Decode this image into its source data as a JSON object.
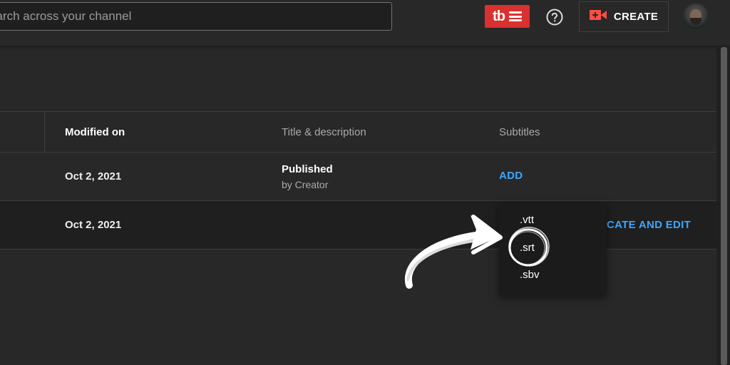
{
  "search": {
    "placeholder": "Search across your channel",
    "visible_text": "earch across your channel"
  },
  "header": {
    "tubebuddy_logo": "tb",
    "help_icon": "help-circle-icon",
    "create_label": "CREATE",
    "colors": {
      "tubebuddy": "#d8312f",
      "create_icon": "#ff4e45",
      "link": "#3ea6ff"
    }
  },
  "table": {
    "columns": [
      {
        "label": "Modified on"
      },
      {
        "label": "Title & description"
      },
      {
        "label": "Subtitles"
      }
    ],
    "rows": [
      {
        "modified": "Oct 2, 2021",
        "title_status": "Published",
        "title_by": "by Creator",
        "subtitles_action": "ADD"
      },
      {
        "modified": "Oct 2, 2021",
        "title_status": "",
        "title_by": "",
        "subtitles_action": "CATE AND EDIT"
      }
    ]
  },
  "dropdown": {
    "options": [
      ".vtt",
      ".srt",
      ".sbv"
    ],
    "highlighted": ".srt"
  }
}
